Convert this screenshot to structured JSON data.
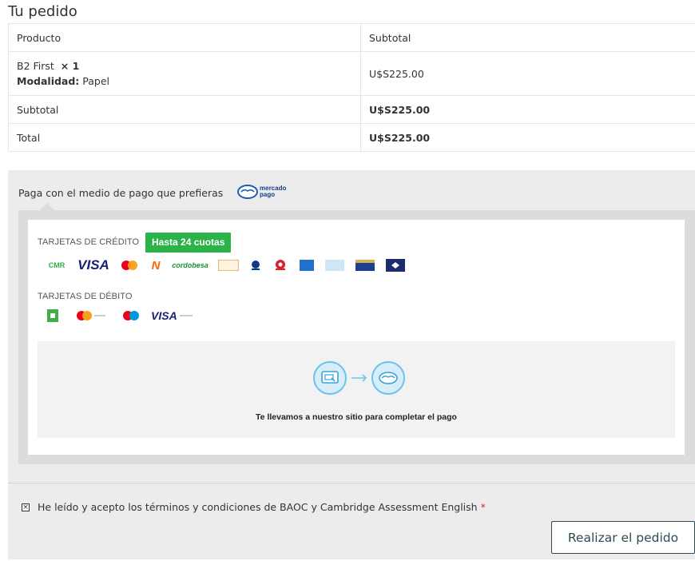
{
  "page": {
    "heading": "Tu pedido"
  },
  "order": {
    "col_product": "Producto",
    "col_subtotal": "Subtotal",
    "item_name": "B2 First",
    "item_qty": "× 1",
    "item_meta_label": "Modalidad:",
    "item_meta_value": "Papel",
    "item_price": "U$S225.00",
    "subtotal_label": "Subtotal",
    "subtotal_value": "U$S225.00",
    "total_label": "Total",
    "total_value": "U$S225.00"
  },
  "payment": {
    "label": "Paga con el medio de pago que prefieras",
    "provider_logo": "mercado pago",
    "provider_line1": "mercado",
    "provider_line2": "pago",
    "credit_title": "TARJETAS DE CRÉDITO",
    "credit_badge": "Hasta 24 cuotas",
    "credit_logos": [
      "cmr-icon",
      "visa-icon",
      "mastercard-icon",
      "naranja-icon",
      "cordobesa-icon",
      "argencard-icon",
      "diners-icon",
      "tarjeta-shopping-icon",
      "amex-icon",
      "cencosud-icon",
      "nativa-icon",
      "cabal-icon"
    ],
    "visa_text": "VISA",
    "cmr_text": "CMR",
    "cordobesa_text": "cordobesa",
    "debit_title": "TARJETAS DE DÉBITO",
    "debit_logos": [
      "cabal-debito-icon",
      "mastercard-debito-icon",
      "maestro-icon",
      "visa-debito-icon"
    ],
    "redirect_text": "Te llevamos a nuestro sitio para completar el pago"
  },
  "terms": {
    "text": "He leído y acepto los términos y condiciones de BAOC y Cambridge Assessment English",
    "required_mark": "*"
  },
  "actions": {
    "place_order": "Realizar el pedido"
  },
  "colors": {
    "badge_green": "#2bb34a",
    "button_border": "#2e4a55",
    "required_red": "#d9262c"
  }
}
